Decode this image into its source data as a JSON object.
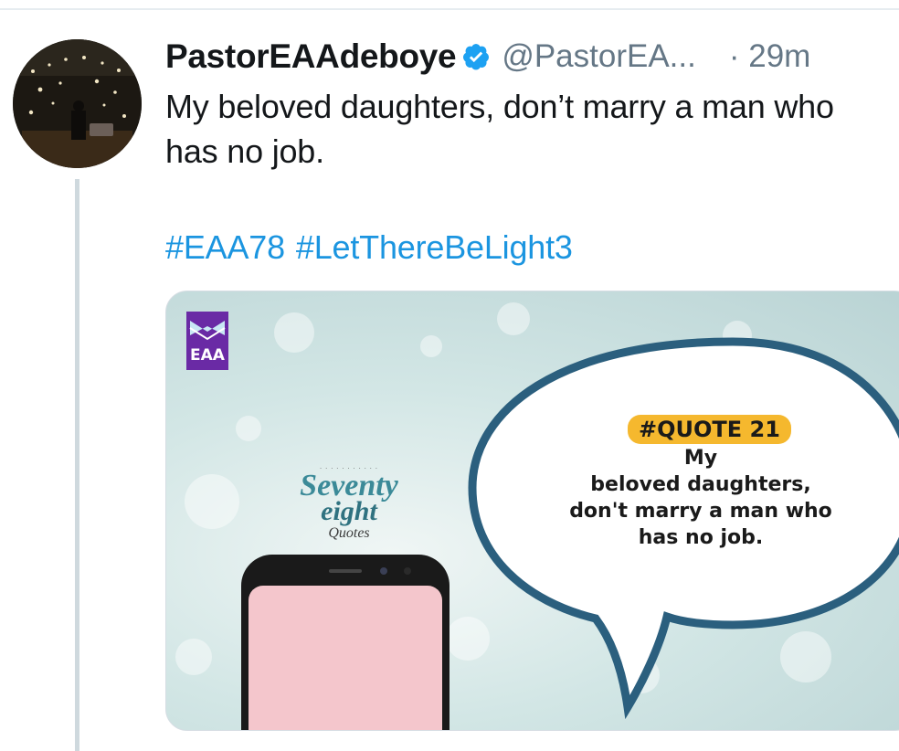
{
  "tweet": {
    "display_name": "PastorEAAdeboye",
    "handle": "@PastorEA...",
    "time": "· 29m",
    "text": "My beloved daughters, don’t marry a man who has no job.",
    "hashtags": [
      "#EAA78",
      "#LetThereBeLight3"
    ],
    "verified": true
  },
  "media": {
    "logo_text": "EAA",
    "brand_line1": "Seventy",
    "brand_line2": "eight",
    "brand_line3": "Quotes",
    "badge": "#QUOTE 21",
    "quote_lines": [
      "My",
      "beloved daughters,",
      "don't marry a man who",
      "has no job."
    ]
  },
  "colors": {
    "link": "#1b95e0",
    "verified": "#1da1f2",
    "muted": "#657786",
    "thread_line": "#cfd9de",
    "bubble_border": "#2b5f7e",
    "badge_bg": "#f5b82e",
    "logo_bg": "#6a2aa5",
    "phone_screen": "#f4c6cc"
  }
}
